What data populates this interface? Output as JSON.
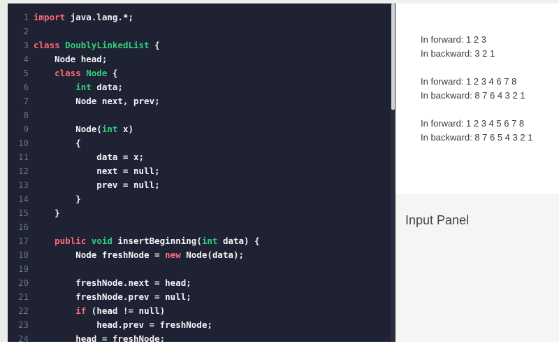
{
  "code": {
    "lines": [
      {
        "n": "1",
        "tokens": [
          {
            "t": "import",
            "c": "kw"
          },
          {
            "t": " java.lang.*;",
            "c": "tx"
          }
        ]
      },
      {
        "n": "2",
        "tokens": []
      },
      {
        "n": "3",
        "tokens": [
          {
            "t": "class",
            "c": "kw"
          },
          {
            "t": " ",
            "c": "tx"
          },
          {
            "t": "DoublyLinkedList",
            "c": "ty"
          },
          {
            "t": " {",
            "c": "tx"
          }
        ]
      },
      {
        "n": "4",
        "tokens": [
          {
            "t": "    Node head;",
            "c": "tx"
          }
        ]
      },
      {
        "n": "5",
        "tokens": [
          {
            "t": "    ",
            "c": "tx"
          },
          {
            "t": "class",
            "c": "kw"
          },
          {
            "t": " ",
            "c": "tx"
          },
          {
            "t": "Node",
            "c": "ty"
          },
          {
            "t": " {",
            "c": "tx"
          }
        ]
      },
      {
        "n": "6",
        "tokens": [
          {
            "t": "        ",
            "c": "tx"
          },
          {
            "t": "int",
            "c": "ty"
          },
          {
            "t": " data;",
            "c": "tx"
          }
        ]
      },
      {
        "n": "7",
        "tokens": [
          {
            "t": "        Node next, prev;",
            "c": "tx"
          }
        ]
      },
      {
        "n": "8",
        "tokens": []
      },
      {
        "n": "9",
        "tokens": [
          {
            "t": "        Node(",
            "c": "tx"
          },
          {
            "t": "int",
            "c": "ty"
          },
          {
            "t": " x)",
            "c": "tx"
          }
        ]
      },
      {
        "n": "10",
        "tokens": [
          {
            "t": "        {",
            "c": "tx"
          }
        ]
      },
      {
        "n": "11",
        "tokens": [
          {
            "t": "            data = x;",
            "c": "tx"
          }
        ]
      },
      {
        "n": "12",
        "tokens": [
          {
            "t": "            next = null;",
            "c": "tx"
          }
        ]
      },
      {
        "n": "13",
        "tokens": [
          {
            "t": "            prev = null;",
            "c": "tx"
          }
        ]
      },
      {
        "n": "14",
        "tokens": [
          {
            "t": "        }",
            "c": "tx"
          }
        ]
      },
      {
        "n": "15",
        "tokens": [
          {
            "t": "    }",
            "c": "tx"
          }
        ]
      },
      {
        "n": "16",
        "tokens": []
      },
      {
        "n": "17",
        "tokens": [
          {
            "t": "    ",
            "c": "tx"
          },
          {
            "t": "public",
            "c": "kw"
          },
          {
            "t": " ",
            "c": "tx"
          },
          {
            "t": "void",
            "c": "ty"
          },
          {
            "t": " insertBeginning(",
            "c": "tx"
          },
          {
            "t": "int",
            "c": "ty"
          },
          {
            "t": " data) {",
            "c": "tx"
          }
        ]
      },
      {
        "n": "18",
        "tokens": [
          {
            "t": "        Node freshNode = ",
            "c": "tx"
          },
          {
            "t": "new",
            "c": "kw"
          },
          {
            "t": " Node(data);",
            "c": "tx"
          }
        ]
      },
      {
        "n": "19",
        "tokens": []
      },
      {
        "n": "20",
        "tokens": [
          {
            "t": "        freshNode.next = head;",
            "c": "tx"
          }
        ]
      },
      {
        "n": "21",
        "tokens": [
          {
            "t": "        freshNode.prev = null;",
            "c": "tx"
          }
        ]
      },
      {
        "n": "22",
        "tokens": [
          {
            "t": "        ",
            "c": "tx"
          },
          {
            "t": "if",
            "c": "kw"
          },
          {
            "t": " (head != null)",
            "c": "tx"
          }
        ]
      },
      {
        "n": "23",
        "tokens": [
          {
            "t": "            head.prev = freshNode;",
            "c": "tx"
          }
        ]
      },
      {
        "n": "24",
        "tokens": [
          {
            "t": "        head = freshNode;",
            "c": "tx"
          }
        ]
      }
    ]
  },
  "output": {
    "lines": [
      "In forward: 1 2 3",
      "In backward: 3 2 1",
      "In forward: 1 2 3 4 6 7 8",
      "In backward: 8 7 6 4 3 2 1",
      "In forward: 1 2 3 4 5 6 7 8",
      "In backward: 8 7 6 5 4 3 2 1"
    ]
  },
  "input_panel": {
    "title": "Input Panel"
  }
}
